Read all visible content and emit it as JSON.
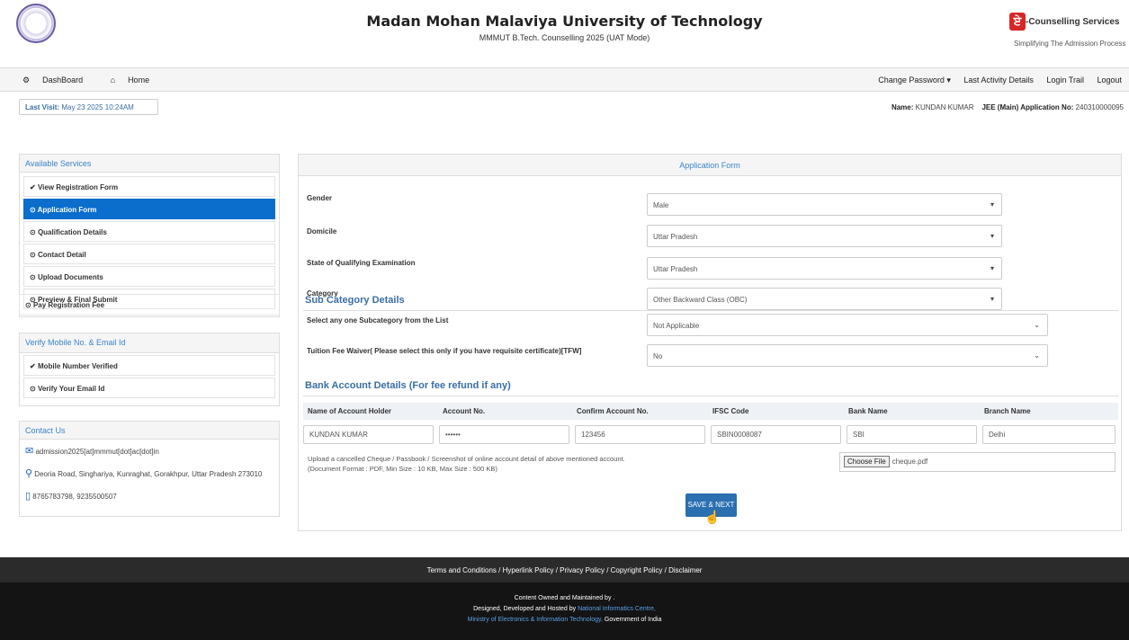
{
  "header": {
    "title": "Madan Mohan Malaviya University of Technology",
    "subtitle": "MMMUT B.Tech. Counselling 2025 (UAT Mode)",
    "service_logo_glyph": "ਏ",
    "service_title": "-Counselling Services",
    "service_tagline": "Simplifying The Admission Process"
  },
  "nav": {
    "dashboard": "DashBoard",
    "home": "Home",
    "change_password": "Change Password ▾",
    "last_activity": "Last Activity Details",
    "login_trail": "Login Trail",
    "logout": "Logout"
  },
  "last_visit": {
    "label": "Last Visit:",
    "value": "May 23 2025 10:24AM"
  },
  "user": {
    "name_label": "Name:",
    "name": "KUNDAN KUMAR",
    "app_label": "JEE (Main) Application No:",
    "app_no": "240310000095"
  },
  "services": {
    "title": "Available Services",
    "items": [
      {
        "icon": "✔",
        "label": "View Registration Form"
      },
      {
        "icon": "⊙",
        "label": "Application Form"
      },
      {
        "icon": "⊙",
        "label": "Qualification Details"
      },
      {
        "icon": "⊙",
        "label": "Contact Detail"
      },
      {
        "icon": "⊙",
        "label": "Upload Documents"
      },
      {
        "icon": "⊙",
        "label": "Preview & Final Submit"
      },
      {
        "icon": "⊙",
        "label": "Pay Registration Fee"
      }
    ]
  },
  "verify": {
    "title": "Verify Mobile No. & Email Id",
    "items": [
      {
        "icon": "✔",
        "label": "Mobile Number Verified"
      },
      {
        "icon": "⊙",
        "label": "Verify Your Email Id"
      }
    ]
  },
  "contact": {
    "title": "Contact Us",
    "email": "admission2025[at]mmmut[dot]ac[dot]in",
    "address": "Deoria Road, Singhariya, Kunraghat, Gorakhpur, Uttar Pradesh 273010",
    "phone": "8765783798, 9235500507"
  },
  "form": {
    "title": "Application Form",
    "gender_label": "Gender",
    "gender_value": "Male",
    "domicile_label": "Domicile",
    "domicile_value": "Uttar Pradesh",
    "state_label": "State of Qualifying Examination",
    "state_value": "Uttar Pradesh",
    "category_label": "Category",
    "category_value": "Other Backward Class (OBC)",
    "subcat_heading": "Sub Category Details",
    "subcat_label": "Select any one Subcategory from the List",
    "subcat_value": "Not Applicable",
    "tfw_label": "Tuition Fee Waiver( Please select this only if you have requisite certificate)[TFW]",
    "tfw_value": "No",
    "bank_heading": "Bank Account Details (For fee refund if any)",
    "bank_cols": [
      "Name of Account Holder",
      "Account No.",
      "Confirm Account No.",
      "IFSC Code",
      "Bank Name",
      "Branch Name"
    ],
    "bank_values": [
      "KUNDAN KUMAR",
      "••••••",
      "123456",
      "SBIN0008087",
      "SBI",
      "Delhi"
    ],
    "upload_line1": "Upload a cancelled Cheque / Passbook / Screenshot of online account detail of above mentioned account.",
    "upload_line2": "(Document Format : PDF, Min Size : 10 KB, Max Size : 500 KB)",
    "choose_file": "Choose File",
    "file_name": "cheque.pdf",
    "save_next": "SAVE & NEXT"
  },
  "footer": {
    "links": "Terms and Conditions / Hyperlink Policy / Privacy Policy / Copyright Policy / Disclaimer",
    "owned": "Content Owned and Maintained by .",
    "designed_prefix": "Designed, Developed and Hosted by ",
    "nic": "National Informatics Centre,",
    "ministry": "Ministry of Electronics & Information Technology,",
    "govt": " Government of India"
  }
}
